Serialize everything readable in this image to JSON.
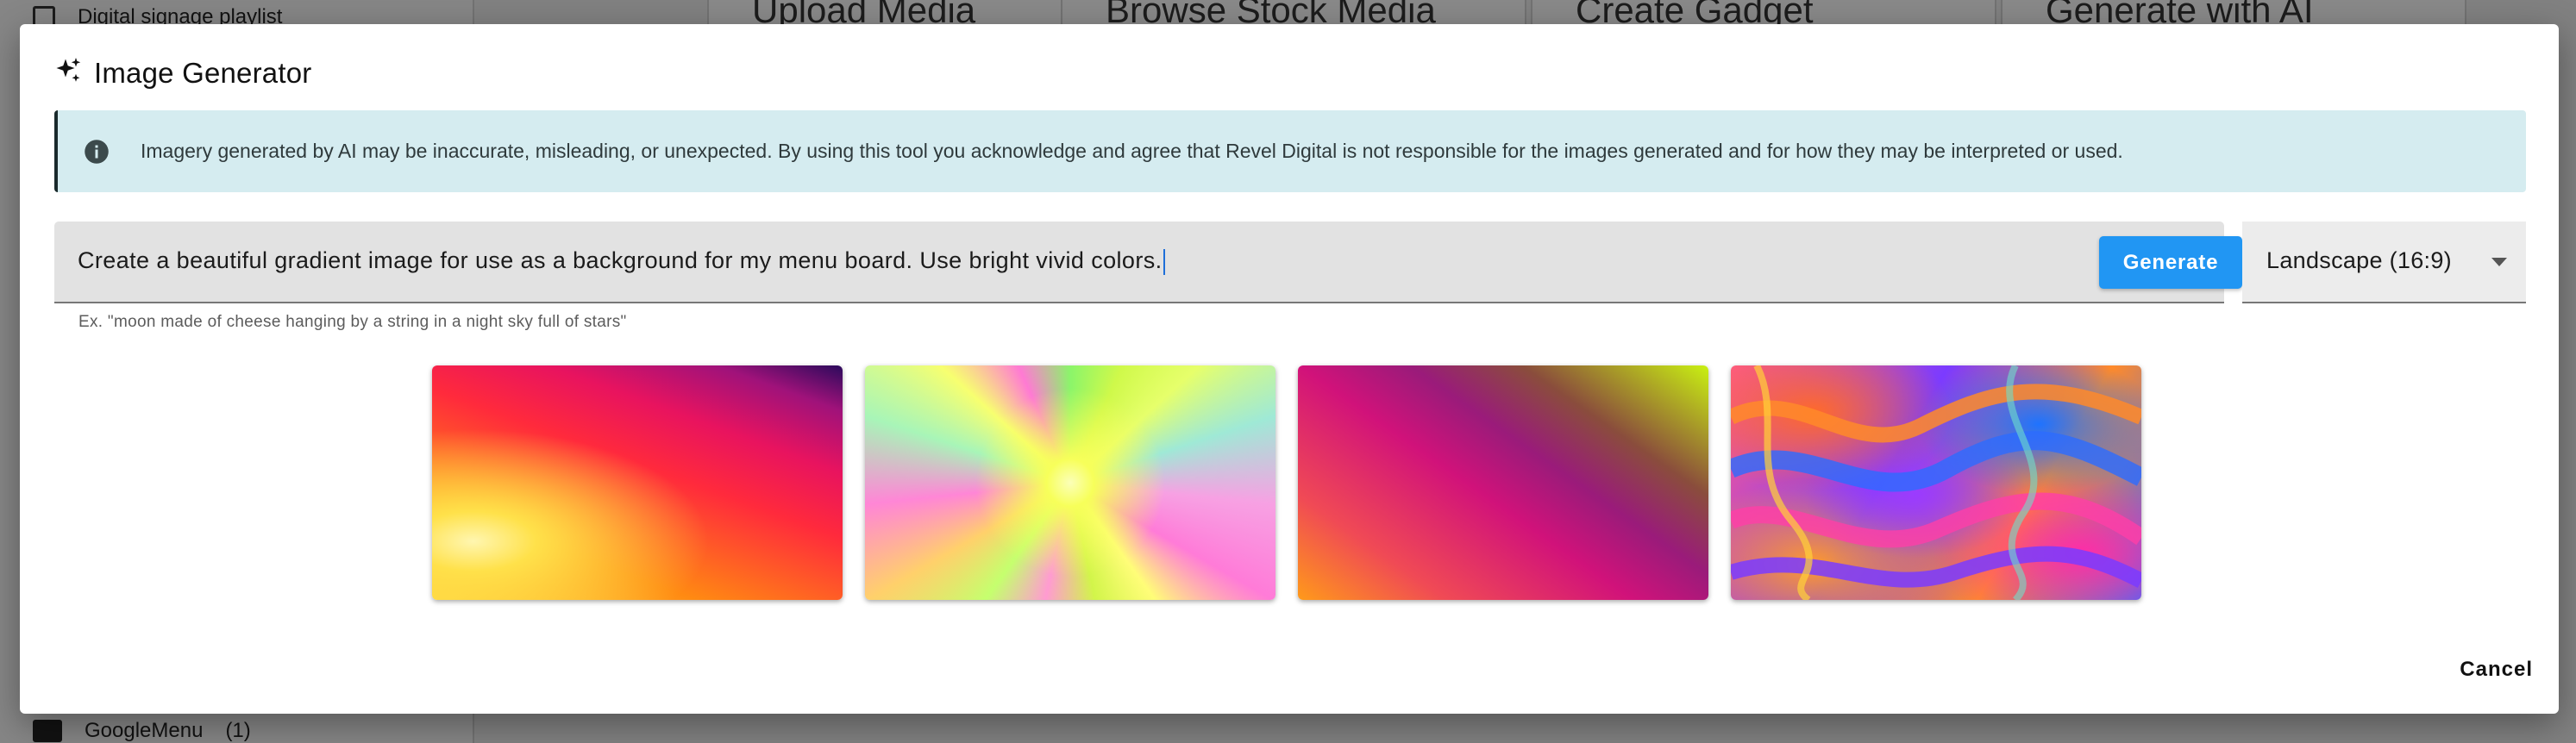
{
  "background": {
    "sidebar": {
      "items": [
        {
          "label": "Digital signage playlist"
        },
        {
          "label": "GoogleMenu",
          "count": "(1)"
        }
      ]
    },
    "tiles": [
      "Upload Media",
      "Browse Stock Media",
      "Create Gadget",
      "Generate with AI"
    ]
  },
  "dialog": {
    "title": "Image Generator",
    "title_icon": "sparkles-icon",
    "alert": {
      "icon": "info-icon",
      "text": "Imagery generated by AI may be inaccurate, misleading, or unexpected. By using this tool you acknowledge and agree that Revel Digital is not responsible for the images generated and for how they may be interpreted or used."
    },
    "prompt": {
      "value": "Create a beautiful gradient image for use as a background for my menu board. Use bright vivid colors.",
      "hint": "Ex. \"moon made of cheese hanging by a string in a night sky full of stars\""
    },
    "generate_label": "Generate",
    "aspect": {
      "selected": "Landscape (16:9)",
      "icon": "chevron-down-icon"
    },
    "results_count": 4,
    "cancel_label": "Cancel"
  },
  "colors": {
    "accent": "#2196f3",
    "alert_bg": "#d5ecf0",
    "field_bg": "#e2e2e2"
  }
}
